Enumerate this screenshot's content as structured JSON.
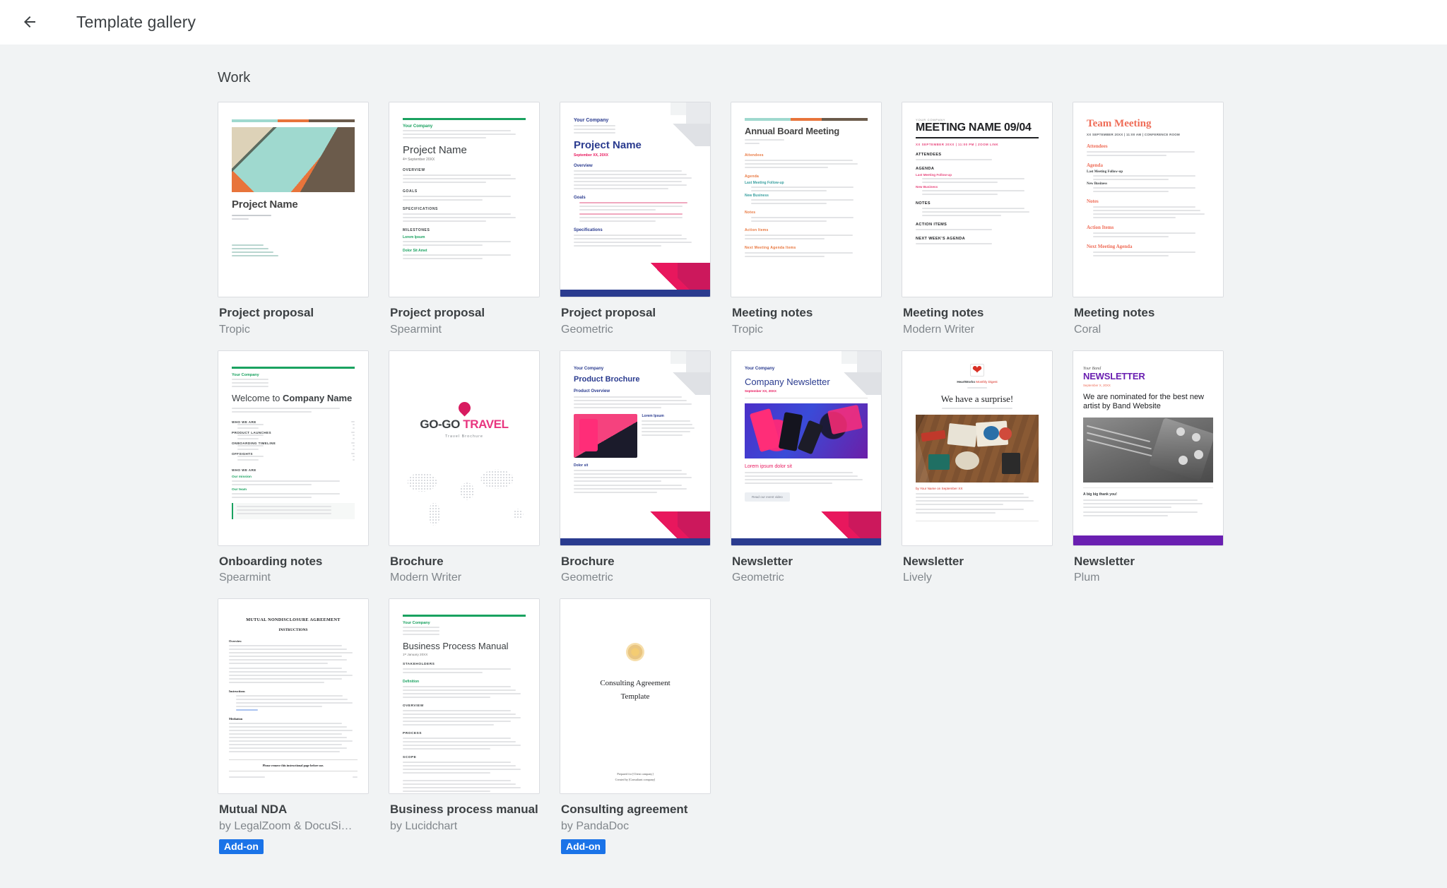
{
  "header": {
    "back_icon": "back-arrow-icon",
    "title": "Template gallery"
  },
  "sections": [
    {
      "title": "Work",
      "templates": [
        {
          "name": "Project proposal",
          "sub": "Tropic",
          "style": "tropic-proposal",
          "badge": null
        },
        {
          "name": "Project proposal",
          "sub": "Spearmint",
          "style": "spearmint-proposal",
          "badge": null
        },
        {
          "name": "Project proposal",
          "sub": "Geometric",
          "style": "geometric-proposal",
          "badge": null
        },
        {
          "name": "Meeting notes",
          "sub": "Tropic",
          "style": "tropic-meeting",
          "badge": null
        },
        {
          "name": "Meeting notes",
          "sub": "Modern Writer",
          "style": "modern-meeting",
          "badge": null
        },
        {
          "name": "Meeting notes",
          "sub": "Coral",
          "style": "coral-meeting",
          "badge": null
        },
        {
          "name": "Onboarding notes",
          "sub": "Spearmint",
          "style": "spearmint-onboarding",
          "badge": null
        },
        {
          "name": "Brochure",
          "sub": "Modern Writer",
          "style": "modern-brochure",
          "badge": null
        },
        {
          "name": "Brochure",
          "sub": "Geometric",
          "style": "geometric-brochure",
          "badge": null
        },
        {
          "name": "Newsletter",
          "sub": "Geometric",
          "style": "geometric-newsletter",
          "badge": null
        },
        {
          "name": "Newsletter",
          "sub": "Lively",
          "style": "lively-newsletter",
          "badge": null
        },
        {
          "name": "Newsletter",
          "sub": "Plum",
          "style": "plum-newsletter",
          "badge": null
        },
        {
          "name": "Mutual NDA",
          "sub": "by LegalZoom & DocuSi…",
          "style": "nda",
          "badge": "Add-on"
        },
        {
          "name": "Business process manual",
          "sub": "by Lucidchart",
          "style": "bpm",
          "badge": null
        },
        {
          "name": "Consulting agreement",
          "sub": "by PandaDoc",
          "style": "consulting",
          "badge": "Add-on"
        }
      ]
    }
  ],
  "thumbnails": {
    "tropic_proposal": {
      "title": "Project Name"
    },
    "spearmint_proposal": {
      "company": "Your Company",
      "title": "Project Name",
      "date": "4ᵗʰ September 20XX",
      "headings": [
        "OVERVIEW",
        "GOALS",
        "SPECIFICATIONS",
        "MILESTONES"
      ],
      "sub_headings": [
        "Lorem Ipsum",
        "Dolor Sit Amet"
      ]
    },
    "geometric_proposal": {
      "company": "Your Company",
      "title": "Project Name",
      "date": "September XX, 20XX",
      "headings": [
        "Overview",
        "Goals",
        "Specifications"
      ]
    },
    "tropic_meeting": {
      "title": "Annual Board Meeting",
      "headings": [
        "Attendees",
        "Agenda",
        "Notes",
        "Action Items",
        "Next Meeting Agenda Items"
      ],
      "sub_headings": [
        "Last Meeting Follow-up",
        "New Business"
      ]
    },
    "modern_meeting": {
      "company": "YOUR COMPANY",
      "title": "MEETING NAME 09/04",
      "meta": "XX SEPTEMBER 20XX | 11:00 PM | ZOOM LINK",
      "headings": [
        "ATTENDEES",
        "AGENDA",
        "NOTES",
        "ACTION ITEMS",
        "NEXT WEEK'S AGENDA"
      ],
      "sub_headings": [
        "Last Meeting Follow-up",
        "New Business"
      ]
    },
    "coral_meeting": {
      "title": "Team Meeting",
      "meta": "XX SEPTEMBER 20XX | 11:00 AM | CONFERENCE ROOM",
      "headings": [
        "Attendees",
        "Agenda",
        "Notes",
        "Action Items",
        "Next Meeting Agenda"
      ],
      "sub_headings": [
        "Last Meeting Follow-up",
        "New Business"
      ]
    },
    "spearmint_onboarding": {
      "company": "Your Company",
      "title_light": "Welcome to ",
      "title_bold": "Company Name",
      "headings": [
        "WHO WE ARE",
        "PRODUCT LAUNCHES",
        "ONBOARDING TIMELINE",
        "OFFSIGHTS",
        "WHO WE ARE"
      ],
      "sub_headings": [
        "Our mission",
        "Our team"
      ]
    },
    "modern_brochure": {
      "logo_dark": "GO-GO ",
      "logo_pink": "TRAVEL",
      "sub": "Travel Brochure",
      "mark": "GO"
    },
    "geometric_brochure": {
      "company": "Your Company",
      "title": "Product Brochure",
      "headings": [
        "Product Overview",
        "Lorem Ipsum",
        "Dolor sit"
      ]
    },
    "geometric_newsletter": {
      "company": "Your Company",
      "title": "Company Newsletter",
      "date": "September XX, 20XX",
      "headline": "Lorem ipsum dolor sit",
      "button": "Read our event video"
    },
    "lively_newsletter": {
      "brand_bold": "HeartWorks",
      "brand_light": " Monthly Digest",
      "title": "We have a surprise!",
      "byline": "by Your Name on September XX"
    },
    "plum_newsletter": {
      "script": "Your Band",
      "title": "NEWSLETTER",
      "date": "September X, 20XX",
      "headline": "We are nominated for the best new artist by Band Website",
      "sub": "A big big thank you!"
    },
    "nda": {
      "title": "MUTUAL NONDISCLOSURE AGREEMENT",
      "subtitle": "INSTRUCTIONS",
      "headings": [
        "Overview",
        "Instructions",
        "Mediation"
      ],
      "footer_note": "Please remove this instructional page before use."
    },
    "bpm": {
      "company": "Your Company",
      "title": "Business Process Manual",
      "date": "1ˢᵗ January 20XX",
      "headings": [
        "STAKEHOLDERS",
        "Definition",
        "OVERVIEW",
        "PROCESS",
        "SCOPE"
      ]
    },
    "consulting": {
      "title_line1": "Consulting Agreement",
      "title_line2": "Template",
      "footer1": "Prepared for [Client company]",
      "footer2": "Created by [Consultant company]"
    }
  },
  "colors": {
    "accent_blue": "#1a73e8",
    "tropic_teal": "#9fd9cf",
    "tropic_orange": "#e8743b",
    "tropic_brown": "#6b5b4b",
    "spearmint_green": "#1aa260",
    "geometric_navy": "#2a3b8f",
    "geometric_pink": "#e8175d",
    "coral": "#ef6c57",
    "plum_purple": "#6a1fb1",
    "lively_red": "#d93025",
    "modern_pink": "#e8467c",
    "text_primary": "#3c4043",
    "text_secondary": "#80868b"
  }
}
